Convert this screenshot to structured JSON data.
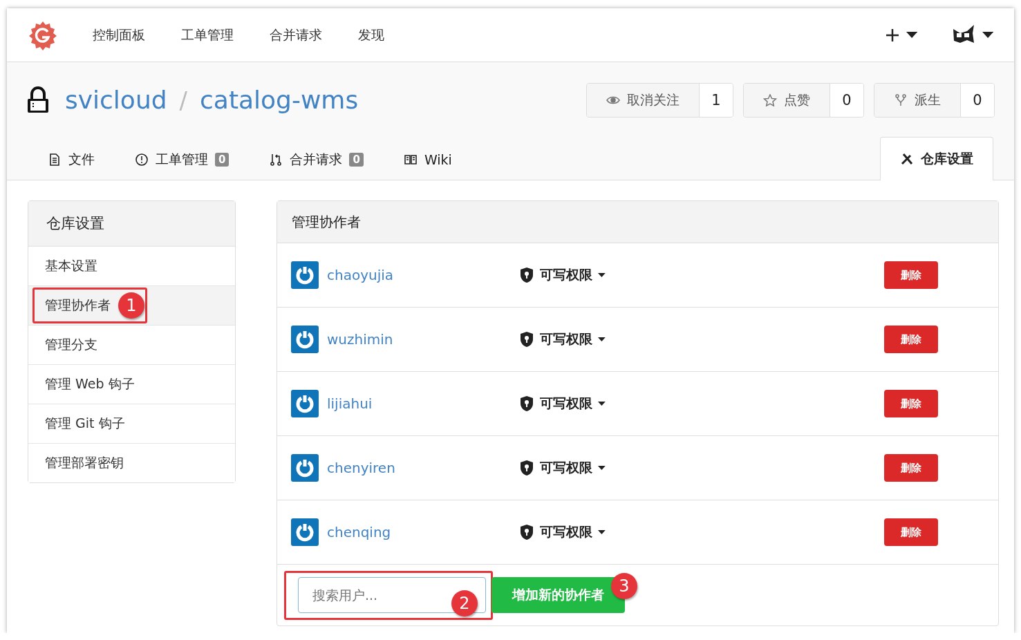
{
  "nav": {
    "items": [
      "控制面板",
      "工单管理",
      "合并请求",
      "发现"
    ]
  },
  "repo": {
    "owner": "svicloud",
    "separator": "/",
    "name": "catalog-wms",
    "actions": [
      {
        "kind": "watch",
        "label": "取消关注",
        "count": "1"
      },
      {
        "kind": "star",
        "label": "点赞",
        "count": "0"
      },
      {
        "kind": "fork",
        "label": "派生",
        "count": "0"
      }
    ]
  },
  "tabs": [
    {
      "kind": "file",
      "label": "文件",
      "selected": false
    },
    {
      "kind": "issue",
      "label": "工单管理",
      "count": "0",
      "selected": false
    },
    {
      "kind": "pull",
      "label": "合并请求",
      "count": "0",
      "selected": false
    },
    {
      "kind": "wiki",
      "label": "Wiki",
      "selected": false
    },
    {
      "kind": "settings",
      "label": "仓库设置",
      "selected": true
    }
  ],
  "sidebar": {
    "title": "仓库设置",
    "items": [
      {
        "label": "基本设置",
        "selected": false
      },
      {
        "label": "管理协作者",
        "selected": true,
        "callout": "1"
      },
      {
        "label": "管理分支",
        "selected": false
      },
      {
        "label": "管理 Web 钩子",
        "selected": false
      },
      {
        "label": "管理 Git 钩子",
        "selected": false
      },
      {
        "label": "管理部署密钥",
        "selected": false
      }
    ]
  },
  "panel": {
    "title": "管理协作者",
    "collaborators": [
      {
        "name": "chaoyujia",
        "permission": "可写权限",
        "action": "删除"
      },
      {
        "name": "wuzhimin",
        "permission": "可写权限",
        "action": "删除"
      },
      {
        "name": "lijiahui",
        "permission": "可写权限",
        "action": "删除"
      },
      {
        "name": "chenyiren",
        "permission": "可写权限",
        "action": "删除"
      },
      {
        "name": "chenqing",
        "permission": "可写权限",
        "action": "删除"
      }
    ],
    "search": {
      "placeholder": "搜索用户...",
      "callout": "2"
    },
    "add_button": {
      "label": "增加新的协作者",
      "callout": "3"
    }
  }
}
